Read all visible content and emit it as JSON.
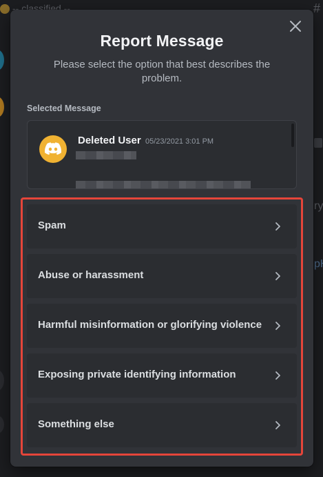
{
  "background": {
    "top_text": "-- classified --",
    "hash_symbol": "#",
    "side_text_1": "ry",
    "side_text_2": "pH"
  },
  "modal": {
    "title": "Report Message",
    "subtitle": "Please select the option that best describes the problem.",
    "close_icon": "close-icon",
    "selected_label": "Selected Message"
  },
  "message": {
    "username": "Deleted User",
    "timestamp": "05/23/2021 3:01 PM",
    "avatar_color": "#f0b232"
  },
  "options": [
    {
      "label": "Spam"
    },
    {
      "label": "Abuse or harassment"
    },
    {
      "label": "Harmful misinformation or glorifying violence"
    },
    {
      "label": "Exposing private identifying information"
    },
    {
      "label": "Something else"
    }
  ],
  "colors": {
    "modal_bg": "#313338",
    "option_bg": "#2b2d31",
    "highlight_border": "#e5453a"
  }
}
